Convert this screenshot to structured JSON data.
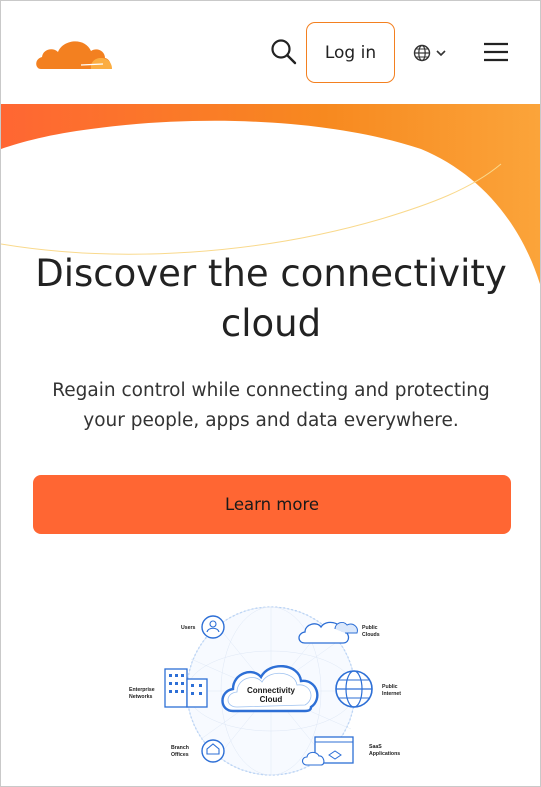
{
  "header": {
    "logo": "cloudflare-logo",
    "login_label": "Log in",
    "icons": {
      "search": "search-icon",
      "language": "globe-icon",
      "menu": "hamburger-menu-icon"
    }
  },
  "hero": {
    "title": "Discover the connectivity cloud",
    "subtitle": "Regain control while connecting and protecting your people, apps and data everywhere.",
    "cta_label": "Learn more"
  },
  "diagram": {
    "center_line1": "Connectivity",
    "center_line2": "Cloud",
    "users": "Users",
    "public_clouds_1": "Public",
    "public_clouds_2": "Clouds",
    "enterprise_1": "Enterprise",
    "enterprise_2": "Networks",
    "public_internet_1": "Public",
    "public_internet_2": "Internet",
    "branch_1": "Branch",
    "branch_2": "Offices",
    "saas_1": "SaaS",
    "saas_2": "Applications"
  },
  "colors": {
    "brand_orange": "#f38020",
    "cta": "#ff6633",
    "diagram_blue": "#2d6fd6"
  }
}
